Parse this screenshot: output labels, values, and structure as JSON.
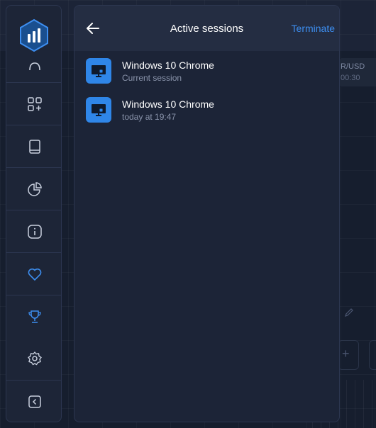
{
  "panel": {
    "title": "Active sessions",
    "terminate_label": "Terminate"
  },
  "sessions": [
    {
      "device": "Windows 10 Chrome",
      "detail": "Current session"
    },
    {
      "device": "Windows 10 Chrome",
      "detail": "today at 19:47"
    }
  ],
  "background": {
    "asset_pair": "R/USD",
    "asset_timer": "00:30"
  },
  "sidebar": {
    "icons": [
      "logo-icon",
      "arc-icon",
      "apps-add-icon",
      "book-icon",
      "pie-chart-icon",
      "info-icon",
      "heart-icon",
      "trophy-icon",
      "gear-icon",
      "collapse-icon"
    ]
  },
  "colors": {
    "accent": "#3d8ef0",
    "device_icon_bg": "#2f86e8",
    "panel_bg": "#1c2437",
    "sidebar_bg": "#1d2537"
  }
}
